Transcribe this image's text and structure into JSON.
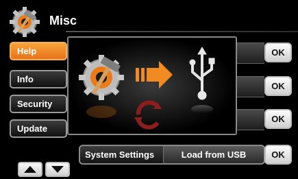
{
  "header": {
    "title": "Misc",
    "icon": "gear-hammer-icon"
  },
  "menu": [
    {
      "label": "Help",
      "active": true
    },
    {
      "label": "Info",
      "active": false
    },
    {
      "label": "Security",
      "active": false
    },
    {
      "label": "Update",
      "active": false
    }
  ],
  "rows": [
    {
      "ok_label": "OK"
    },
    {
      "ok_label": "OK"
    },
    {
      "ok_label": "OK"
    }
  ],
  "bottom": {
    "settings_label": "System Settings",
    "usb_button_label": "Load from USB",
    "ok_label": "OK"
  },
  "nav": {
    "up_icon": "arrow-up-icon",
    "down_icon": "arrow-down-icon"
  },
  "popup": {
    "icons": [
      "gear-hammer-icon",
      "arrow-right-icon",
      "usb-icon",
      "refresh-icon"
    ]
  },
  "colors": {
    "accent": "#f28a22",
    "background": "#000000"
  }
}
